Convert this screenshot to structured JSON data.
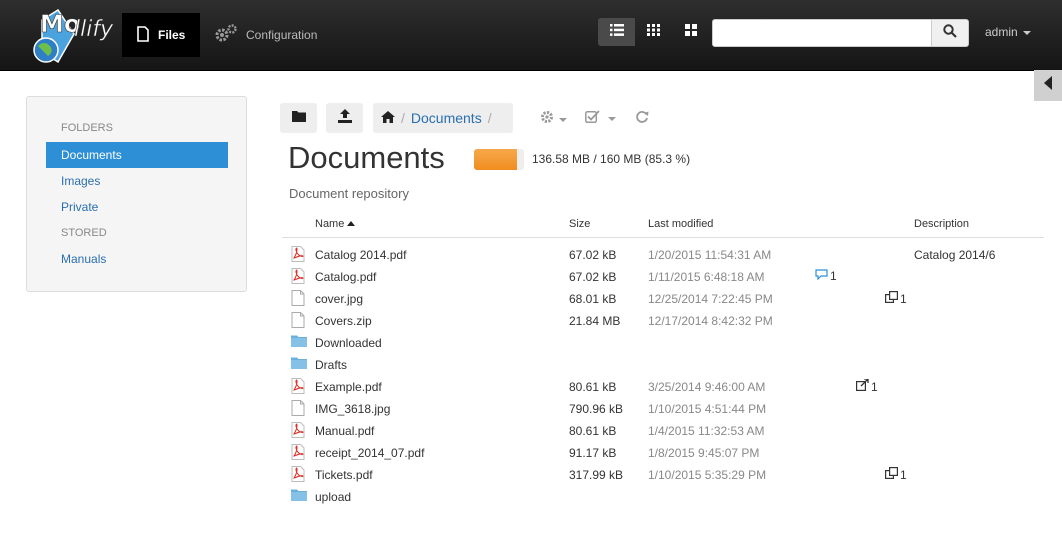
{
  "app": {
    "logo_text": "Mollify",
    "nav": [
      {
        "label": "Files",
        "active": true,
        "icon": "file-icon"
      },
      {
        "label": "Configuration",
        "active": false,
        "icon": "gears-icon"
      }
    ],
    "view_modes": [
      "list-view-icon",
      "grid-small-icon",
      "grid-large-icon"
    ],
    "search": {
      "value": "",
      "placeholder": ""
    },
    "user": "admin"
  },
  "sidebar": {
    "sections": [
      {
        "heading": "FOLDERS",
        "items": [
          {
            "label": "Documents",
            "active": true
          },
          {
            "label": "Images",
            "active": false
          },
          {
            "label": "Private",
            "active": false
          }
        ]
      },
      {
        "heading": "STORED",
        "items": [
          {
            "label": "Manuals",
            "active": false
          }
        ]
      }
    ]
  },
  "toolbar": {
    "breadcrumb": [
      "Documents"
    ],
    "buttons": [
      "folder-icon",
      "upload-icon",
      "home-icon",
      "gear-icon",
      "checkbox-icon",
      "refresh-icon"
    ]
  },
  "folder": {
    "title": "Documents",
    "quota_text": "136.58 MB / 160 MB (85.3 %)",
    "quota_fraction": 0.853,
    "description": "Document repository"
  },
  "table": {
    "columns": {
      "name": "Name",
      "size": "Size",
      "modified": "Last modified",
      "description": "Description"
    },
    "sort": {
      "column": "name",
      "direction": "asc"
    },
    "rows": [
      {
        "name": "Catalog 2014.pdf",
        "type": "pdf",
        "size": "67.02 kB",
        "modified": "1/20/2015 11:54:31 AM",
        "description": "Catalog 2014/6"
      },
      {
        "name": "Catalog.pdf",
        "type": "pdf",
        "size": "67.02 kB",
        "modified": "1/11/2015 6:48:18 AM",
        "comments": "1"
      },
      {
        "name": "cover.jpg",
        "type": "file",
        "size": "68.01 kB",
        "modified": "12/25/2014 7:22:45 PM",
        "copies": "1"
      },
      {
        "name": "Covers.zip",
        "type": "file",
        "size": "21.84 MB",
        "modified": "12/17/2014 8:42:32 PM"
      },
      {
        "name": "Downloaded",
        "type": "folder"
      },
      {
        "name": "Drafts",
        "type": "folder"
      },
      {
        "name": "Example.pdf",
        "type": "pdf",
        "size": "80.61 kB",
        "modified": "3/25/2014 9:46:00 AM",
        "shares": "1"
      },
      {
        "name": "IMG_3618.jpg",
        "type": "file",
        "size": "790.96 kB",
        "modified": "1/10/2015 4:51:44 PM"
      },
      {
        "name": "Manual.pdf",
        "type": "pdf",
        "size": "80.61 kB",
        "modified": "1/4/2015 11:32:53 AM"
      },
      {
        "name": "receipt_2014_07.pdf",
        "type": "pdf",
        "size": "91.17 kB",
        "modified": "1/8/2015 9:45:07 PM"
      },
      {
        "name": "Tickets.pdf",
        "type": "pdf",
        "size": "317.99 kB",
        "modified": "1/10/2015 5:35:29 PM",
        "copies": "1"
      },
      {
        "name": "upload",
        "type": "folder"
      }
    ]
  },
  "colors": {
    "accent": "#2d8fd5",
    "link": "#2a6fb0",
    "quota": "#f08d1f",
    "topbar": "#1e1e1e",
    "pdf": "#d9332a",
    "folder": "#6ab0dc"
  }
}
